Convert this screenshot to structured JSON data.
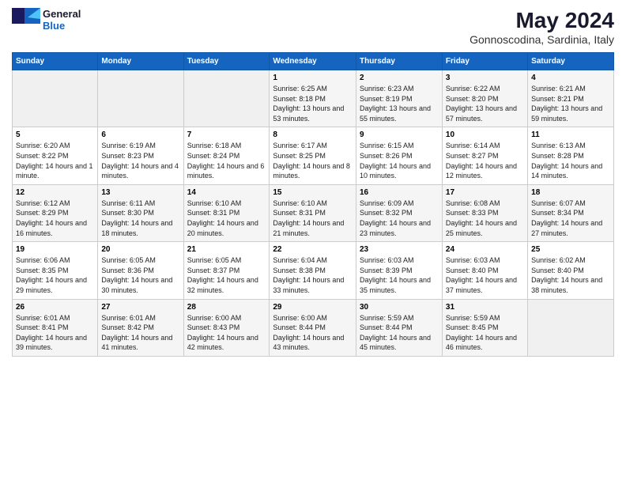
{
  "logo": {
    "general": "General",
    "blue": "Blue"
  },
  "title": "May 2024",
  "subtitle": "Gonnoscodina, Sardinia, Italy",
  "days_header": [
    "Sunday",
    "Monday",
    "Tuesday",
    "Wednesday",
    "Thursday",
    "Friday",
    "Saturday"
  ],
  "weeks": [
    [
      {
        "day": "",
        "sunrise": "",
        "sunset": "",
        "daylight": ""
      },
      {
        "day": "",
        "sunrise": "",
        "sunset": "",
        "daylight": ""
      },
      {
        "day": "",
        "sunrise": "",
        "sunset": "",
        "daylight": ""
      },
      {
        "day": "1",
        "sunrise": "Sunrise: 6:25 AM",
        "sunset": "Sunset: 8:18 PM",
        "daylight": "Daylight: 13 hours and 53 minutes."
      },
      {
        "day": "2",
        "sunrise": "Sunrise: 6:23 AM",
        "sunset": "Sunset: 8:19 PM",
        "daylight": "Daylight: 13 hours and 55 minutes."
      },
      {
        "day": "3",
        "sunrise": "Sunrise: 6:22 AM",
        "sunset": "Sunset: 8:20 PM",
        "daylight": "Daylight: 13 hours and 57 minutes."
      },
      {
        "day": "4",
        "sunrise": "Sunrise: 6:21 AM",
        "sunset": "Sunset: 8:21 PM",
        "daylight": "Daylight: 13 hours and 59 minutes."
      }
    ],
    [
      {
        "day": "5",
        "sunrise": "Sunrise: 6:20 AM",
        "sunset": "Sunset: 8:22 PM",
        "daylight": "Daylight: 14 hours and 1 minute."
      },
      {
        "day": "6",
        "sunrise": "Sunrise: 6:19 AM",
        "sunset": "Sunset: 8:23 PM",
        "daylight": "Daylight: 14 hours and 4 minutes."
      },
      {
        "day": "7",
        "sunrise": "Sunrise: 6:18 AM",
        "sunset": "Sunset: 8:24 PM",
        "daylight": "Daylight: 14 hours and 6 minutes."
      },
      {
        "day": "8",
        "sunrise": "Sunrise: 6:17 AM",
        "sunset": "Sunset: 8:25 PM",
        "daylight": "Daylight: 14 hours and 8 minutes."
      },
      {
        "day": "9",
        "sunrise": "Sunrise: 6:15 AM",
        "sunset": "Sunset: 8:26 PM",
        "daylight": "Daylight: 14 hours and 10 minutes."
      },
      {
        "day": "10",
        "sunrise": "Sunrise: 6:14 AM",
        "sunset": "Sunset: 8:27 PM",
        "daylight": "Daylight: 14 hours and 12 minutes."
      },
      {
        "day": "11",
        "sunrise": "Sunrise: 6:13 AM",
        "sunset": "Sunset: 8:28 PM",
        "daylight": "Daylight: 14 hours and 14 minutes."
      }
    ],
    [
      {
        "day": "12",
        "sunrise": "Sunrise: 6:12 AM",
        "sunset": "Sunset: 8:29 PM",
        "daylight": "Daylight: 14 hours and 16 minutes."
      },
      {
        "day": "13",
        "sunrise": "Sunrise: 6:11 AM",
        "sunset": "Sunset: 8:30 PM",
        "daylight": "Daylight: 14 hours and 18 minutes."
      },
      {
        "day": "14",
        "sunrise": "Sunrise: 6:10 AM",
        "sunset": "Sunset: 8:31 PM",
        "daylight": "Daylight: 14 hours and 20 minutes."
      },
      {
        "day": "15",
        "sunrise": "Sunrise: 6:10 AM",
        "sunset": "Sunset: 8:31 PM",
        "daylight": "Daylight: 14 hours and 21 minutes."
      },
      {
        "day": "16",
        "sunrise": "Sunrise: 6:09 AM",
        "sunset": "Sunset: 8:32 PM",
        "daylight": "Daylight: 14 hours and 23 minutes."
      },
      {
        "day": "17",
        "sunrise": "Sunrise: 6:08 AM",
        "sunset": "Sunset: 8:33 PM",
        "daylight": "Daylight: 14 hours and 25 minutes."
      },
      {
        "day": "18",
        "sunrise": "Sunrise: 6:07 AM",
        "sunset": "Sunset: 8:34 PM",
        "daylight": "Daylight: 14 hours and 27 minutes."
      }
    ],
    [
      {
        "day": "19",
        "sunrise": "Sunrise: 6:06 AM",
        "sunset": "Sunset: 8:35 PM",
        "daylight": "Daylight: 14 hours and 29 minutes."
      },
      {
        "day": "20",
        "sunrise": "Sunrise: 6:05 AM",
        "sunset": "Sunset: 8:36 PM",
        "daylight": "Daylight: 14 hours and 30 minutes."
      },
      {
        "day": "21",
        "sunrise": "Sunrise: 6:05 AM",
        "sunset": "Sunset: 8:37 PM",
        "daylight": "Daylight: 14 hours and 32 minutes."
      },
      {
        "day": "22",
        "sunrise": "Sunrise: 6:04 AM",
        "sunset": "Sunset: 8:38 PM",
        "daylight": "Daylight: 14 hours and 33 minutes."
      },
      {
        "day": "23",
        "sunrise": "Sunrise: 6:03 AM",
        "sunset": "Sunset: 8:39 PM",
        "daylight": "Daylight: 14 hours and 35 minutes."
      },
      {
        "day": "24",
        "sunrise": "Sunrise: 6:03 AM",
        "sunset": "Sunset: 8:40 PM",
        "daylight": "Daylight: 14 hours and 37 minutes."
      },
      {
        "day": "25",
        "sunrise": "Sunrise: 6:02 AM",
        "sunset": "Sunset: 8:40 PM",
        "daylight": "Daylight: 14 hours and 38 minutes."
      }
    ],
    [
      {
        "day": "26",
        "sunrise": "Sunrise: 6:01 AM",
        "sunset": "Sunset: 8:41 PM",
        "daylight": "Daylight: 14 hours and 39 minutes."
      },
      {
        "day": "27",
        "sunrise": "Sunrise: 6:01 AM",
        "sunset": "Sunset: 8:42 PM",
        "daylight": "Daylight: 14 hours and 41 minutes."
      },
      {
        "day": "28",
        "sunrise": "Sunrise: 6:00 AM",
        "sunset": "Sunset: 8:43 PM",
        "daylight": "Daylight: 14 hours and 42 minutes."
      },
      {
        "day": "29",
        "sunrise": "Sunrise: 6:00 AM",
        "sunset": "Sunset: 8:44 PM",
        "daylight": "Daylight: 14 hours and 43 minutes."
      },
      {
        "day": "30",
        "sunrise": "Sunrise: 5:59 AM",
        "sunset": "Sunset: 8:44 PM",
        "daylight": "Daylight: 14 hours and 45 minutes."
      },
      {
        "day": "31",
        "sunrise": "Sunrise: 5:59 AM",
        "sunset": "Sunset: 8:45 PM",
        "daylight": "Daylight: 14 hours and 46 minutes."
      },
      {
        "day": "",
        "sunrise": "",
        "sunset": "",
        "daylight": ""
      }
    ]
  ]
}
